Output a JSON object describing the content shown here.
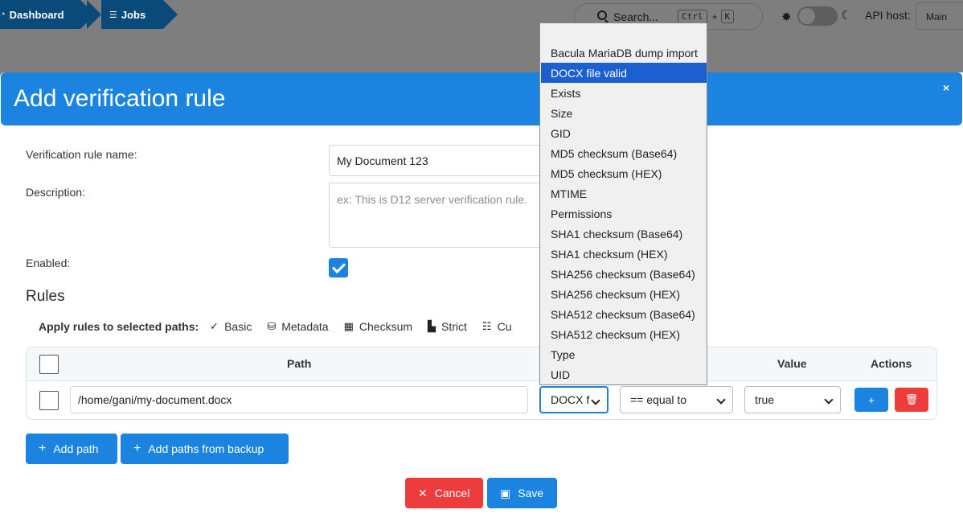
{
  "topbar": {
    "breadcrumbs": [
      {
        "label": "Dashboard"
      },
      {
        "label": "Jobs"
      }
    ],
    "search": {
      "label": "Search...",
      "kbd1": "Ctrl",
      "plus": "+",
      "kbd2": "K"
    },
    "api_host_label": "API host:",
    "api_host_value": "Main"
  },
  "modal": {
    "title": "Add verification rule",
    "close": "×",
    "fields": {
      "name_label": "Verification rule name:",
      "name_value": "My Document 123",
      "description_label": "Description:",
      "description_placeholder": "ex: This is D12 server verification rule.",
      "enabled_label": "Enabled:"
    },
    "rules_heading": "Rules",
    "apply_label": "Apply rules to selected paths:",
    "apply_options": [
      "Basic",
      "Metadata",
      "Checksum",
      "Strict",
      "Cu"
    ],
    "table": {
      "headers": {
        "path": "Path",
        "value": "Value",
        "actions": "Actions"
      },
      "row": {
        "path": "/home/gani/my-document.docx",
        "type": "DOCX f",
        "operator": "== equal to",
        "value": "true",
        "add": "+",
        "delete": "🗑"
      }
    },
    "buttons": {
      "add_path": "Add path",
      "add_from_backup": "Add paths from backup",
      "cancel": "Cancel",
      "save": "Save"
    }
  },
  "dropdown": {
    "options": [
      "",
      "Bacula MariaDB dump import",
      "DOCX file valid",
      "Exists",
      "Size",
      "GID",
      "MD5 checksum (Base64)",
      "MD5 checksum (HEX)",
      "MTIME",
      "Permissions",
      "SHA1 checksum (Base64)",
      "SHA1 checksum (HEX)",
      "SHA256 checksum (Base64)",
      "SHA256 checksum (HEX)",
      "SHA512 checksum (Base64)",
      "SHA512 checksum (HEX)",
      "Type",
      "UID"
    ],
    "selected": "DOCX file valid"
  },
  "colors": {
    "primary": "#1b84e0",
    "danger": "#ee3b3b",
    "highlight": "#1b5fd0"
  }
}
